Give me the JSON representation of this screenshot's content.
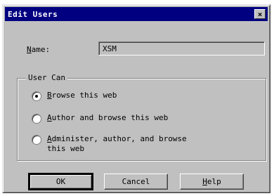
{
  "dialog": {
    "title": "Edit Users",
    "close_glyph": "×"
  },
  "name": {
    "label_hotkey": "N",
    "label_rest": "ame:",
    "value": "XSM"
  },
  "user_can": {
    "legend": "User Can",
    "options": [
      {
        "hotkey": "B",
        "rest": "rowse this web",
        "checked": true
      },
      {
        "hotkey": "A",
        "rest": "uthor and browse this web",
        "checked": false
      },
      {
        "hotkey": "A",
        "rest": "dminister, author, and browse",
        "line2": "this web",
        "checked": false
      }
    ]
  },
  "buttons": {
    "ok": "OK",
    "cancel": "Cancel",
    "help_hotkey": "H",
    "help_rest": "elp"
  }
}
